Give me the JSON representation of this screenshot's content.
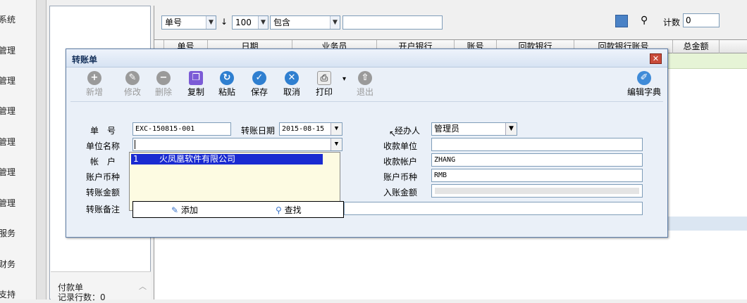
{
  "sidebar": {
    "items": [
      "系统",
      "管理",
      "管理",
      "管理",
      "管理",
      "管理",
      "管理",
      "服务",
      "财务",
      "支持"
    ]
  },
  "tree_footer": {
    "line1": "付款单",
    "line2": "记录行数：0"
  },
  "search": {
    "field_label": "单号",
    "sort_icon": "↓",
    "page_size": "100",
    "operator": "包含",
    "value": "",
    "count_label": "计数",
    "count_value": "0"
  },
  "grid": {
    "columns": [
      "单号",
      "日期",
      "业务员",
      "开户银行",
      "账号",
      "回款银行",
      "回款银行账号",
      "总金额"
    ]
  },
  "dialog": {
    "title": "转账单",
    "close_label": "✕",
    "toolbar": {
      "new": "新增",
      "edit": "修改",
      "delete": "删除",
      "copy": "复制",
      "paste": "粘贴",
      "save": "保存",
      "cancel": "取消",
      "print": "打印",
      "exit": "退出",
      "dict": "编辑字典"
    },
    "form": {
      "doc_no_label": "单　号",
      "doc_no": "EXC-150815-001",
      "date_label": "转账日期",
      "date": "2015-08-15",
      "handler_label": "经办人",
      "handler": "管理员",
      "company_label": "单位名称",
      "company": "",
      "account_label": "帐　户",
      "currency_label": "账户币种",
      "amount_label": "转账金额",
      "remark_label": "转账备注",
      "recv_company_label": "收款单位",
      "recv_company": "",
      "recv_account_label": "收款帐户",
      "recv_account": "ZHANG",
      "recv_currency_label": "账户币种",
      "recv_currency": "RMB",
      "in_amount_label": "入账金额",
      "in_amount": ""
    },
    "popup": {
      "row_no": "1",
      "row_name": "火凤凰软件有限公司",
      "add_label": "添加",
      "find_label": "查找"
    }
  },
  "colors": {
    "selection": "#1a2bd1",
    "dialog_bg": "#eaf0f8",
    "close_red": "#c94b3a"
  }
}
